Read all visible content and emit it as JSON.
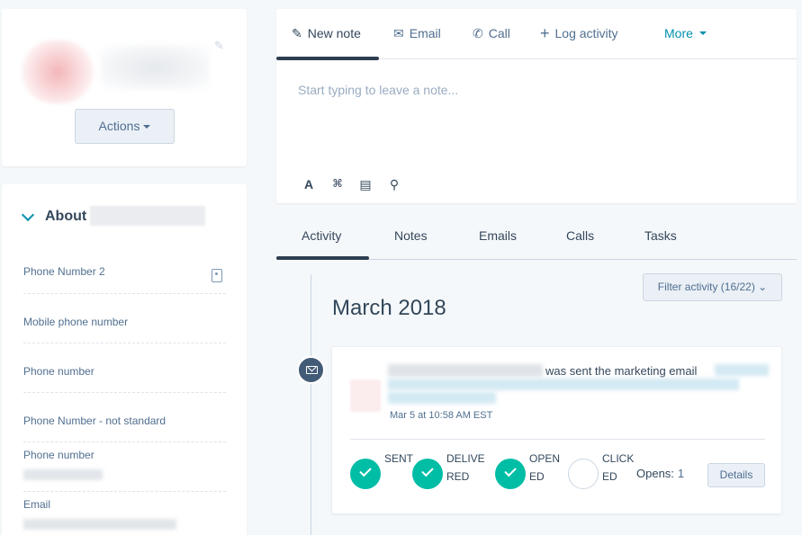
{
  "profile": {
    "actions_label": "Actions",
    "edit_icon": "pencil-icon"
  },
  "about": {
    "title": "About",
    "fields": [
      {
        "label": "Phone Number 2"
      },
      {
        "label": "Mobile phone number"
      },
      {
        "label": "Phone number"
      },
      {
        "label": "Phone Number - not standard"
      },
      {
        "label": "Phone number"
      },
      {
        "label": "Email"
      }
    ]
  },
  "composer": {
    "tabs": [
      {
        "label": "New note",
        "icon": "edit-icon"
      },
      {
        "label": "Email",
        "icon": "envelope-icon"
      },
      {
        "label": "Call",
        "icon": "phone-icon"
      },
      {
        "label": "Log activity",
        "icon": "plus-icon"
      },
      {
        "label": "More",
        "icon": "caret-down-icon"
      }
    ],
    "placeholder": "Start typing to leave a note..."
  },
  "timeline": {
    "tabs": [
      "Activity",
      "Notes",
      "Emails",
      "Calls",
      "Tasks"
    ],
    "filter_label": "Filter activity (16/22) ⌄",
    "month": "March 2018"
  },
  "activity": {
    "text": "was sent the marketing email",
    "time": "Mar 5 at 10:58 AM EST",
    "statuses": [
      {
        "label": "SENT",
        "done": true
      },
      {
        "label": "DELIVERED",
        "done": true
      },
      {
        "label": "OPENED",
        "done": true
      },
      {
        "label": "CLICKED",
        "done": false
      }
    ],
    "opens_label": "Opens:",
    "opens_count": "1",
    "details_label": "Details"
  },
  "colors": {
    "accent": "#0091ae",
    "status_done": "#00bda5",
    "dark_tab": "#2d3e50"
  }
}
